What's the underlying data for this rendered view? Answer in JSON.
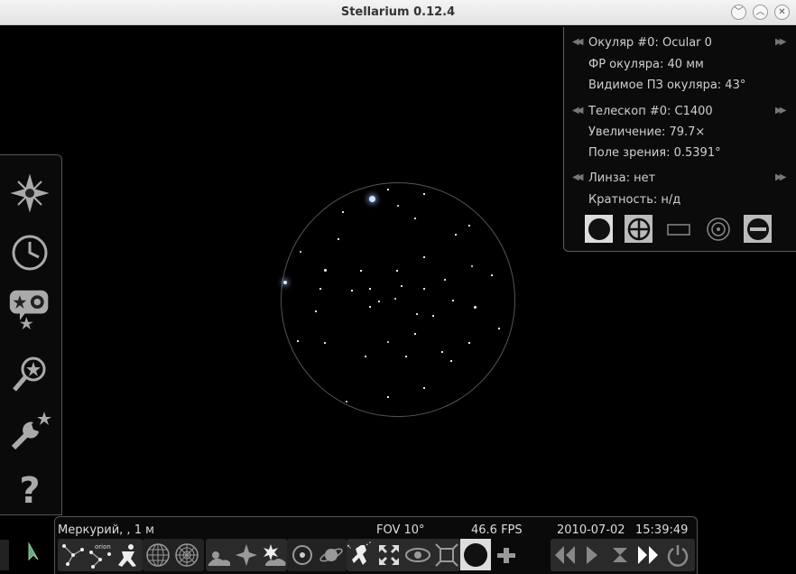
{
  "window": {
    "title": "Stellarium 0.12.4",
    "buttons": [
      "minimize",
      "maximize",
      "close"
    ]
  },
  "ocular_panel": {
    "ocular": "Окуляр #0: Ocular 0",
    "ocular_fl": "ФР окуляра: 40 мм",
    "ocular_afov": "Видимое ПЗ окуляра: 43°",
    "telescope": "Телескоп #0: C1400",
    "magnification": "Увеличение: 79.7×",
    "fov": "Поле зрения: 0.5391°",
    "lens": "Линза: нет",
    "multiplicity": "Кратность: н/д",
    "icons": [
      "ocular-view-icon",
      "crosshair-icon",
      "sensor-frame-icon",
      "telrad-icon",
      "ocular-config-icon"
    ]
  },
  "left_bar": {
    "items": [
      "sky-location-icon",
      "date-time-icon",
      "sky-viewing-options-icon",
      "search-icon",
      "configuration-icon",
      "help-icon"
    ]
  },
  "status_bar": {
    "location": "Меркурий, , 1 м",
    "fov": "FOV 10°",
    "fps": "46.6 FPS",
    "date": "2010-07-02",
    "time": "15:39:49"
  },
  "bottom_toolbar": {
    "icons": [
      "constellation-lines-icon",
      "constellation-labels-icon",
      "constellation-art-icon",
      "equatorial-grid-icon",
      "azimuthal-grid-icon",
      "ground-icon",
      "cardinal-points-icon",
      "atmosphere-icon",
      "nebulas-icon",
      "planet-labels-icon",
      "satellites-icon",
      "equatorial-mount-icon",
      "center-object-icon",
      "night-mode-icon",
      "full-screen-icon",
      "ocular-icon",
      "telescope-control-icon",
      "decrease-time-speed-icon",
      "real-time-speed-icon",
      "set-now-icon",
      "increase-time-speed-icon",
      "quit-icon"
    ]
  }
}
